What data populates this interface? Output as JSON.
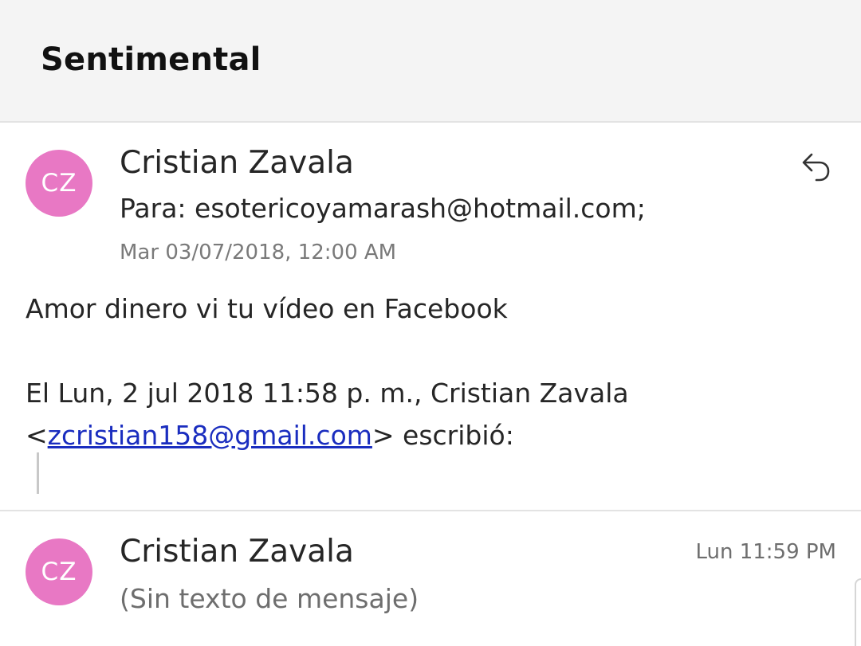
{
  "header": {
    "title": "Sentimental"
  },
  "accent_color": "#e878c4",
  "link_color": "#1a2dbf",
  "messages": [
    {
      "avatar_initials": "CZ",
      "sender": "Cristian Zavala",
      "to_line": "Para: esotericoyamarash@hotmail.com;",
      "date": "Mar 03/07/2018, 12:00 AM",
      "reply_icon": "reply-icon",
      "body": {
        "line1": "Amor dinero vi tu vídeo en Facebook",
        "quote_header": "El Lun, 2 jul 2018 11:58 p. m., Cristian Zavala",
        "quote_email_prefix": "<",
        "quote_email": "zcristian158@gmail.com",
        "quote_email_suffix": "> escribió:"
      }
    },
    {
      "avatar_initials": "CZ",
      "sender": "Cristian Zavala",
      "time": "Lun 11:59 PM",
      "preview": "(Sin texto de mensaje)"
    }
  ]
}
